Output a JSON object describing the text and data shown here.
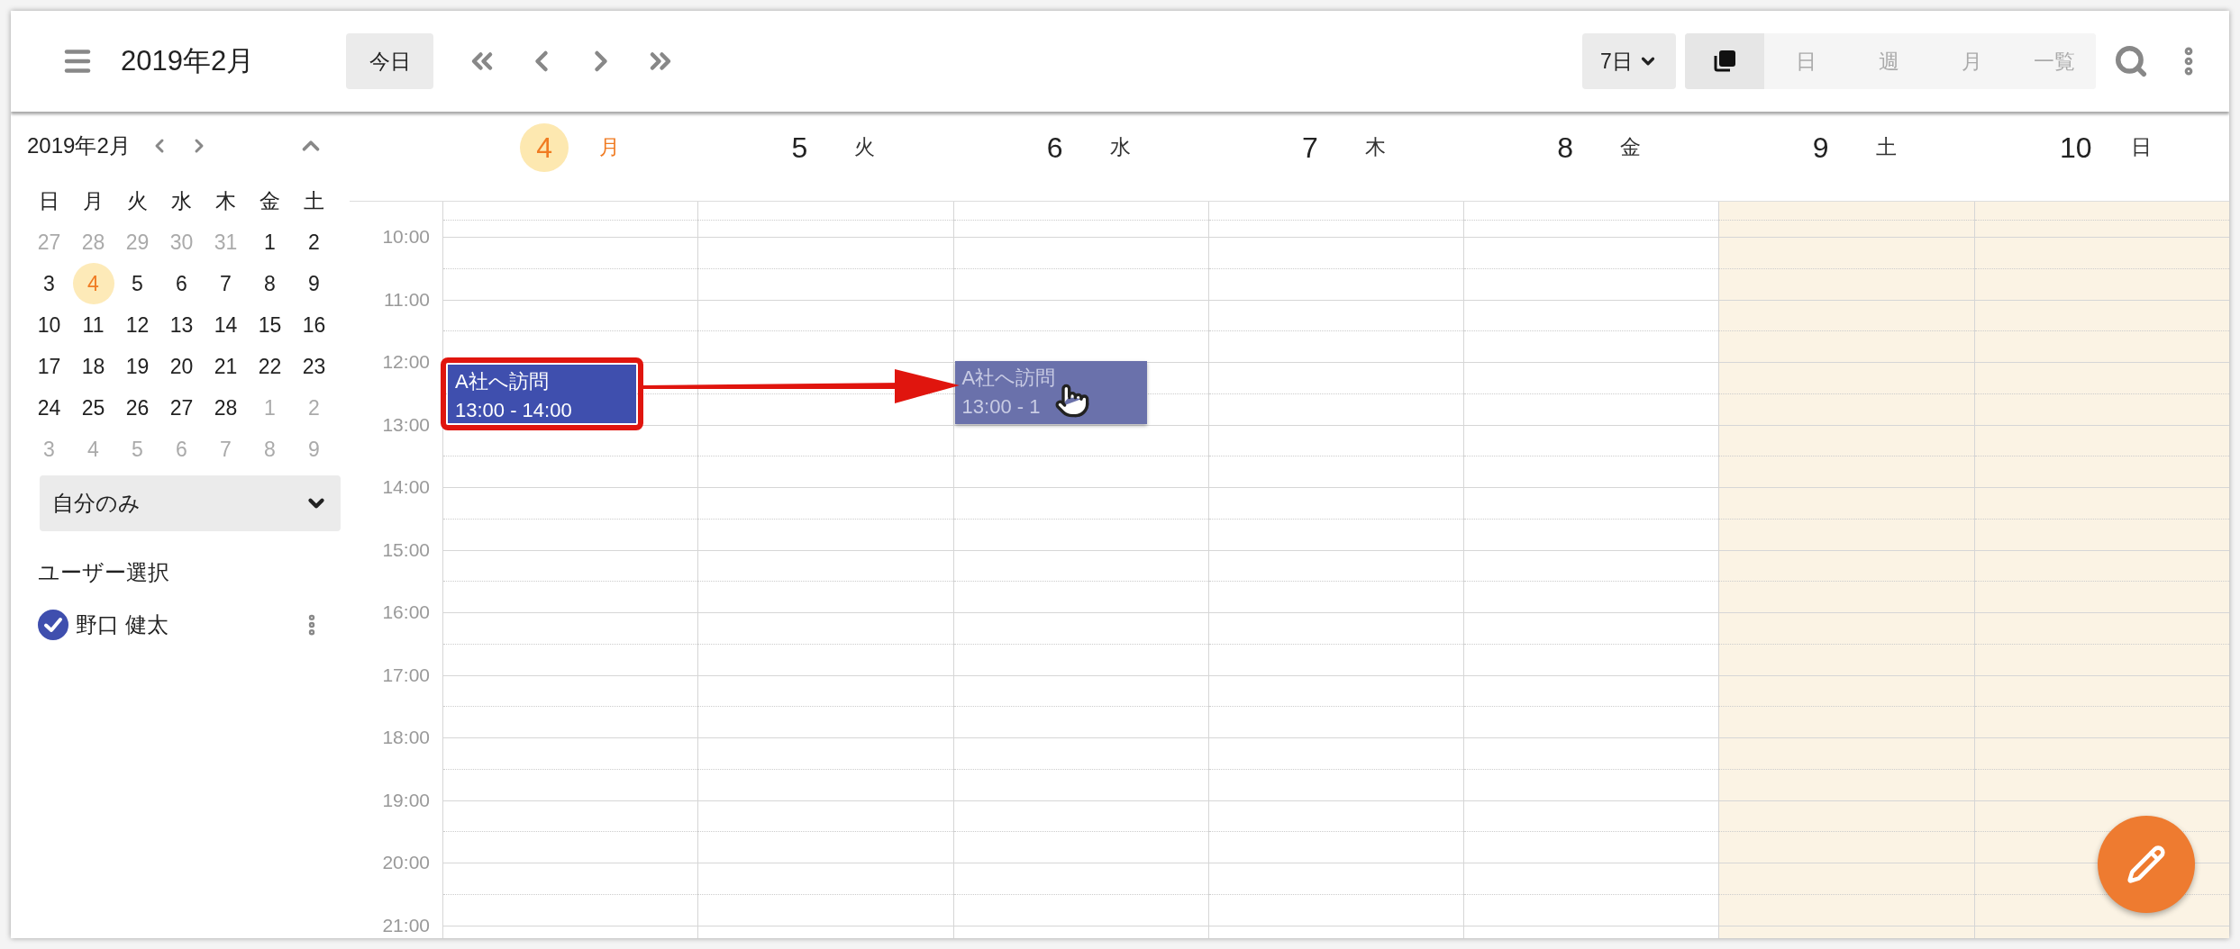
{
  "toolbar": {
    "title": "2019年2月",
    "today_button": "今日",
    "range_select": "7日",
    "views": [
      {
        "kind": "icon",
        "selected": true
      },
      {
        "kind": "text",
        "label": "日",
        "selected": false
      },
      {
        "kind": "text",
        "label": "週",
        "selected": false
      },
      {
        "kind": "text",
        "label": "月",
        "selected": false
      },
      {
        "kind": "text",
        "label": "一覧",
        "selected": false
      }
    ]
  },
  "sidebar": {
    "mini_calendar": {
      "title": "2019年2月",
      "weekdays": [
        "日",
        "月",
        "火",
        "水",
        "木",
        "金",
        "土"
      ],
      "weeks": [
        [
          {
            "day": "27",
            "outside": true,
            "today": false
          },
          {
            "day": "28",
            "outside": true,
            "today": false
          },
          {
            "day": "29",
            "outside": true,
            "today": false
          },
          {
            "day": "30",
            "outside": true,
            "today": false
          },
          {
            "day": "31",
            "outside": true,
            "today": false
          },
          {
            "day": "1",
            "outside": false,
            "today": false
          },
          {
            "day": "2",
            "outside": false,
            "today": false
          }
        ],
        [
          {
            "day": "3",
            "outside": false,
            "today": false
          },
          {
            "day": "4",
            "outside": false,
            "today": true
          },
          {
            "day": "5",
            "outside": false,
            "today": false
          },
          {
            "day": "6",
            "outside": false,
            "today": false
          },
          {
            "day": "7",
            "outside": false,
            "today": false
          },
          {
            "day": "8",
            "outside": false,
            "today": false
          },
          {
            "day": "9",
            "outside": false,
            "today": false
          }
        ],
        [
          {
            "day": "10",
            "outside": false,
            "today": false
          },
          {
            "day": "11",
            "outside": false,
            "today": false
          },
          {
            "day": "12",
            "outside": false,
            "today": false
          },
          {
            "day": "13",
            "outside": false,
            "today": false
          },
          {
            "day": "14",
            "outside": false,
            "today": false
          },
          {
            "day": "15",
            "outside": false,
            "today": false
          },
          {
            "day": "16",
            "outside": false,
            "today": false
          }
        ],
        [
          {
            "day": "17",
            "outside": false,
            "today": false
          },
          {
            "day": "18",
            "outside": false,
            "today": false
          },
          {
            "day": "19",
            "outside": false,
            "today": false
          },
          {
            "day": "20",
            "outside": false,
            "today": false
          },
          {
            "day": "21",
            "outside": false,
            "today": false
          },
          {
            "day": "22",
            "outside": false,
            "today": false
          },
          {
            "day": "23",
            "outside": false,
            "today": false
          }
        ],
        [
          {
            "day": "24",
            "outside": false,
            "today": false
          },
          {
            "day": "25",
            "outside": false,
            "today": false
          },
          {
            "day": "26",
            "outside": false,
            "today": false
          },
          {
            "day": "27",
            "outside": false,
            "today": false
          },
          {
            "day": "28",
            "outside": false,
            "today": false
          },
          {
            "day": "1",
            "outside": true,
            "today": false
          },
          {
            "day": "2",
            "outside": true,
            "today": false
          }
        ],
        [
          {
            "day": "3",
            "outside": true,
            "today": false
          },
          {
            "day": "4",
            "outside": true,
            "today": false
          },
          {
            "day": "5",
            "outside": true,
            "today": false
          },
          {
            "day": "6",
            "outside": true,
            "today": false
          },
          {
            "day": "7",
            "outside": true,
            "today": false
          },
          {
            "day": "8",
            "outside": true,
            "today": false
          },
          {
            "day": "9",
            "outside": true,
            "today": false
          }
        ]
      ]
    },
    "filter": {
      "value": "自分のみ"
    },
    "users_heading": "ユーザー選択",
    "users": [
      {
        "name": "野口 健太",
        "checked": true
      }
    ]
  },
  "week": {
    "hours": [
      "10:00",
      "11:00",
      "12:00",
      "13:00",
      "14:00",
      "15:00",
      "16:00",
      "17:00",
      "18:00",
      "19:00",
      "20:00",
      "21:00"
    ],
    "days": [
      {
        "date": "4",
        "weekday": "月",
        "today": true,
        "weekend": false,
        "events": [
          {
            "kind": "event",
            "title": "A社へ訪問",
            "time": "13:00 - 14:00"
          }
        ]
      },
      {
        "date": "5",
        "weekday": "火",
        "today": false,
        "weekend": false
      },
      {
        "date": "6",
        "weekday": "水",
        "today": false,
        "weekend": false,
        "events": [
          {
            "kind": "drag_preview",
            "title": "A社へ訪問",
            "time": "13:00 - 1"
          }
        ]
      },
      {
        "date": "7",
        "weekday": "木",
        "today": false,
        "weekend": false
      },
      {
        "date": "8",
        "weekday": "金",
        "today": false,
        "weekend": false
      },
      {
        "date": "9",
        "weekday": "土",
        "today": false,
        "weekend": true
      },
      {
        "date": "10",
        "weekday": "日",
        "today": false,
        "weekend": true
      }
    ]
  }
}
